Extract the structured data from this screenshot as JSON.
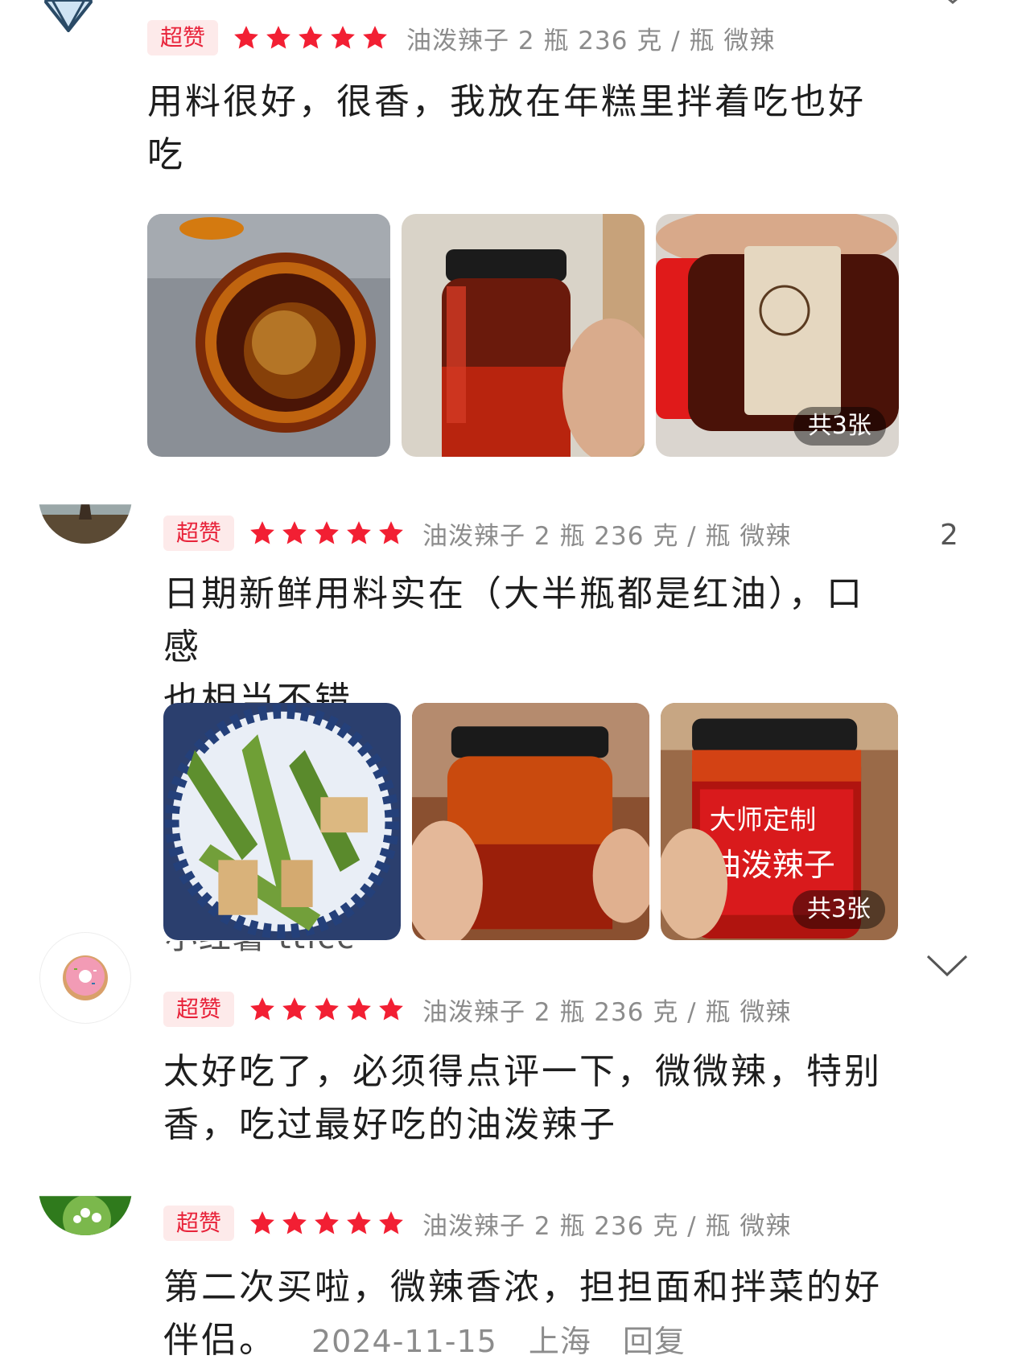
{
  "reviews": [
    {
      "badge": "超赞",
      "rating": 5,
      "spec": "油泼辣子 2 瓶   236 克 / 瓶   微辣",
      "text_line1": "用料很好，很香，我放在年糕里拌着吃也好",
      "text_line2": "吃",
      "photo_count": "共3张"
    },
    {
      "badge": "超赞",
      "rating": 5,
      "spec": "油泼辣子 2 瓶   236 克 / 瓶   微辣",
      "reply_count": "2",
      "text_line1": "日期新鲜用料实在（大半瓶都是红油），口感",
      "text_line2": "也相当不错",
      "photo_count": "共3张",
      "jar_label_line1": "大师定制",
      "jar_label_line2": "油泼辣子"
    },
    {
      "username": "小红薯 tticc",
      "badge": "超赞",
      "rating": 5,
      "spec": "油泼辣子 2 瓶   236 克 / 瓶   微辣",
      "text_line1": "太好吃了，必须得点评一下，微微辣，特别",
      "text_line2": "香，吃过最好吃的油泼辣子"
    },
    {
      "badge": "超赞",
      "rating": 5,
      "spec": "油泼辣子 2 瓶   236 克 / 瓶   微辣",
      "text_line1": "第二次买啦，微辣香浓，担担面和拌菜的好",
      "text_line2_main": "伴侣。",
      "date": "2024-11-15",
      "location": "上海",
      "reply_label": "回复"
    }
  ],
  "colors": {
    "badge_text": "#e8233a",
    "badge_bg": "#fdeaea",
    "star": "#f21f33",
    "meta_gray": "#8c8c8c"
  },
  "icons": [
    "diamond-avatar",
    "paris-avatar",
    "donut-avatar",
    "flower-avatar",
    "star-icon",
    "chevron-down-icon"
  ]
}
